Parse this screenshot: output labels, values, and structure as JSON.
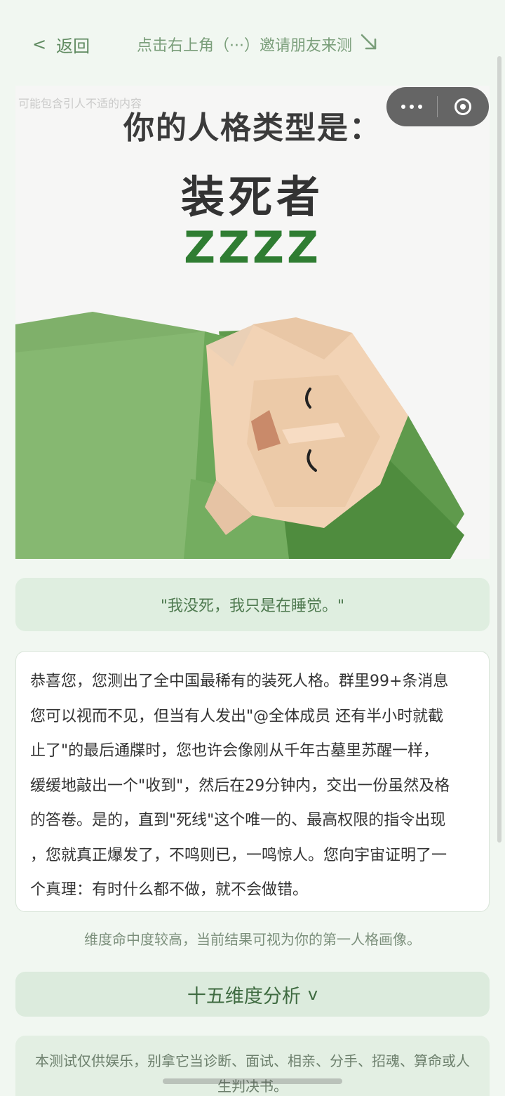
{
  "nav": {
    "back_chevron": "<",
    "back_label": "返回",
    "invite_text": "点击右上角（···）邀请朋友来测",
    "invite_arrow": "↘"
  },
  "hero": {
    "watermark": "可能包含引人不适的内容",
    "title": "你的人格类型是：",
    "type_name": "装死者",
    "zzz": "ZZZZ"
  },
  "capsule": {
    "more_icon": "more-dots-icon",
    "close_icon": "target-close-icon"
  },
  "quote": "\"我没死，我只是在睡觉。\"",
  "description_lines": [
    "恭喜您，您测出了全中国最稀有的装死人格。群里99+条消息",
    "您可以视而不见，但当有人发出\"@全体成员 还有半小时就截",
    "止了\"的最后通牒时，您也许会像刚从千年古墓里苏醒一样，",
    "缓缓地敲出一个\"收到\"，然后在29分钟内，交出一份虽然及格",
    "的答卷。是的，直到\"死线\"这个唯一的、最高权限的指令出现",
    "，您就真正爆发了，不鸣则已，一鸣惊人。您向宇宙证明了一",
    "个真理：有时什么都不做，就不会做错。"
  ],
  "note": "维度命中度较高，当前结果可视为你的第一人格画像。",
  "analysis": {
    "label": "十五维度分析",
    "toggle": "v"
  },
  "disclaimer": "本测试仅供娱乐，别拿它当诊断、面试、相亲、分手、招魂、算命或人生判决书。",
  "colors": {
    "background": "#f1f7f1",
    "accent_green": "#5f8a60",
    "blanket_green": "#6fa35c",
    "zzz_green": "#2f7d32"
  }
}
